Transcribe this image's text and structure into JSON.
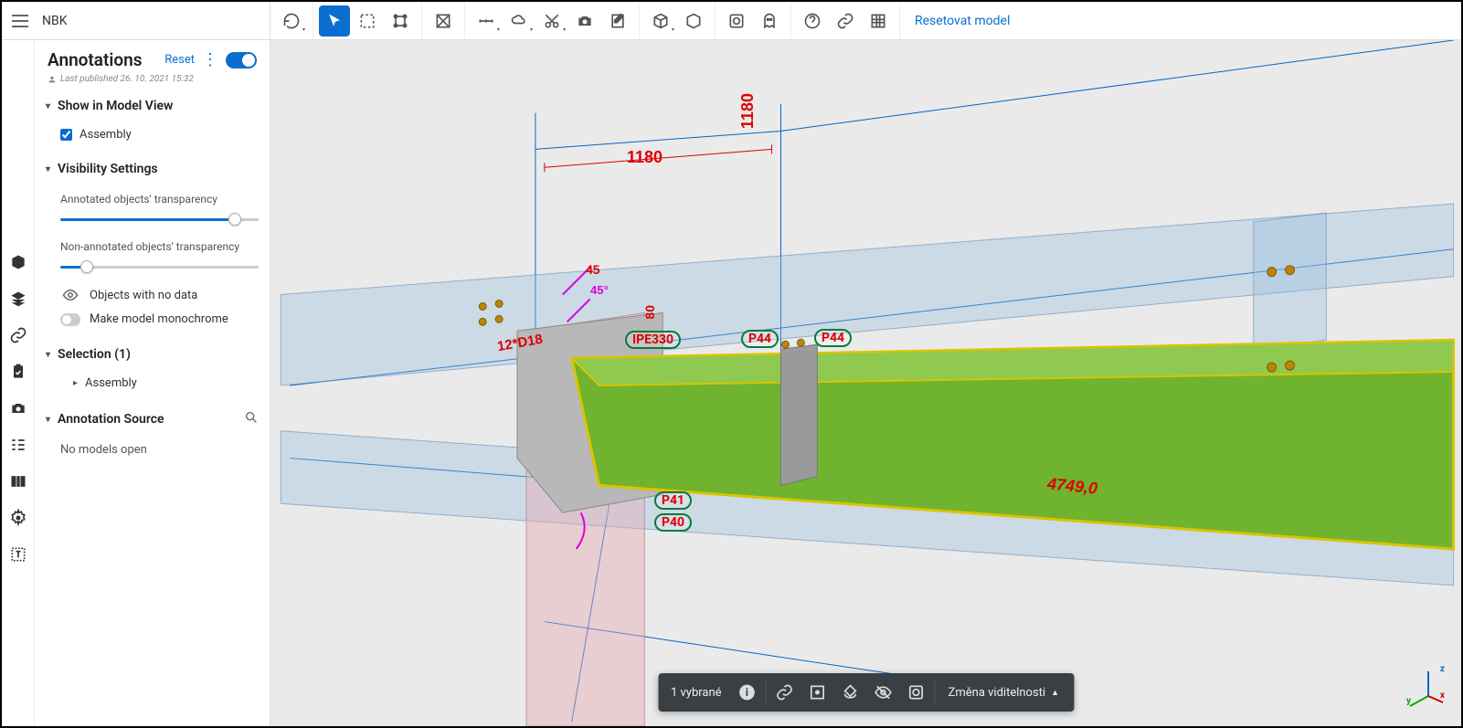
{
  "header": {
    "project": "NBK",
    "reset_model": "Resetovat model"
  },
  "panel": {
    "title": "Annotations",
    "reset": "Reset",
    "last_published": "Last published 26. 10. 2021 15:32",
    "show_head": "Show in Model View",
    "assembly_chk": "Assembly",
    "vis_head": "Visibility Settings",
    "slider1_label": "Annotated objects' transparency",
    "slider2_label": "Non-annotated objects' transparency",
    "obj_no_data": "Objects with no data",
    "monochrome": "Make model monochrome",
    "selection_head": "Selection (1)",
    "selection_item": "Assembly",
    "ann_src_head": "Annotation Source",
    "ann_src_body": "No models open"
  },
  "status": {
    "selected": "1 vybrané",
    "visibility": "Změna viditelnosti"
  },
  "dims": {
    "d1180a": "1180",
    "d1180b": "1180",
    "d45": "45",
    "d45deg": "45°",
    "p44a": "P44",
    "p44b": "P44",
    "ipe": "IPE330",
    "p41": "P41",
    "p40": "P40",
    "d4749": "4749,0",
    "d12d18": "12*D18",
    "d80": "80"
  },
  "axis": {
    "x": "x",
    "y": "y",
    "z": "z"
  }
}
